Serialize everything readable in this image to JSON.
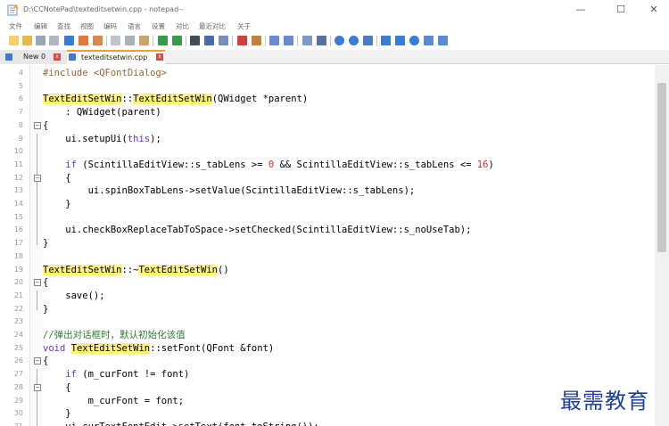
{
  "window": {
    "title": "D:\\CCNotePad\\texteditsetwin.cpp - notepad--",
    "minimize_glyph": "—",
    "maximize_glyph": "☐",
    "close_glyph": "✕"
  },
  "menu": [
    "文件",
    "编辑",
    "查找",
    "视图",
    "编码",
    "语言",
    "设置",
    "对比",
    "最近对比",
    "关于"
  ],
  "tabs": {
    "new_label": "New 0",
    "active_label": "texteditsetwin.cpp",
    "close_glyph": "x"
  },
  "code_lines": [
    {
      "n": "4",
      "fold": "",
      "html": "<span class='pp'>#include &lt;QFontDialog&gt;</span>"
    },
    {
      "n": "5",
      "fold": "",
      "html": ""
    },
    {
      "n": "6",
      "fold": "",
      "html": "<span class='hl'>TextEditSetWin</span>::<span class='hl'>TextEditSetWin</span>(QWidget *parent)"
    },
    {
      "n": "7",
      "fold": "",
      "html": "    : QWidget(parent)"
    },
    {
      "n": "8",
      "fold": "⊟",
      "html": "{"
    },
    {
      "n": "9",
      "fold": "",
      "html": "    ui.setupUi(<span class='kw'>this</span>);"
    },
    {
      "n": "10",
      "fold": "",
      "html": ""
    },
    {
      "n": "11",
      "fold": "",
      "html": "    <span class='kw'>if</span> (ScintillaEditView::s_tabLens &gt;= <span class='num'>0</span> &amp;&amp; ScintillaEditView::s_tabLens &lt;= <span class='num'>16</span>)"
    },
    {
      "n": "12",
      "fold": "⊟",
      "html": "    {"
    },
    {
      "n": "13",
      "fold": "",
      "html": "        ui.spinBoxTabLens-&gt;setValue(ScintillaEditView::s_tabLens);"
    },
    {
      "n": "14",
      "fold": "",
      "html": "    }"
    },
    {
      "n": "15",
      "fold": "",
      "html": ""
    },
    {
      "n": "16",
      "fold": "",
      "html": "    ui.checkBoxReplaceTabToSpace-&gt;setChecked(ScintillaEditView::s_noUseTab);"
    },
    {
      "n": "17",
      "fold": "",
      "html": "}"
    },
    {
      "n": "18",
      "fold": "",
      "html": ""
    },
    {
      "n": "19",
      "fold": "",
      "html": "<span class='hl'>TextEditSetWin</span>::~<span class='hl'>TextEditSetWin</span>()"
    },
    {
      "n": "20",
      "fold": "⊟",
      "html": "{"
    },
    {
      "n": "21",
      "fold": "",
      "html": "    save();"
    },
    {
      "n": "22",
      "fold": "",
      "html": "}"
    },
    {
      "n": "23",
      "fold": "",
      "html": ""
    },
    {
      "n": "24",
      "fold": "",
      "html": "<span class='cm'>//弹出对话框时，默认初始化该值</span>"
    },
    {
      "n": "25",
      "fold": "",
      "html": "<span class='kw'>void</span> <span class='hl'>TextEditSetWin</span>::setFont(QFont &amp;font)"
    },
    {
      "n": "26",
      "fold": "⊟",
      "html": "{"
    },
    {
      "n": "27",
      "fold": "",
      "html": "    <span class='kw'>if</span> (m_curFont != font)"
    },
    {
      "n": "28",
      "fold": "⊟",
      "html": "    {"
    },
    {
      "n": "29",
      "fold": "",
      "html": "        m_curFont = font;"
    },
    {
      "n": "30",
      "fold": "",
      "html": "    }"
    },
    {
      "n": "31",
      "fold": "",
      "html": "    ui.curTextFontEdit-&gt;setText(font.toString());"
    }
  ],
  "watermark": "最需教育",
  "colors": {
    "highlight": "#fff37a",
    "keyword": "#6a33b9",
    "number": "#d03030",
    "preprocessor": "#a0622d",
    "comment": "#2f7a2f",
    "active_tab_accent": "#f0a030",
    "watermark": "#1f3f9f"
  }
}
